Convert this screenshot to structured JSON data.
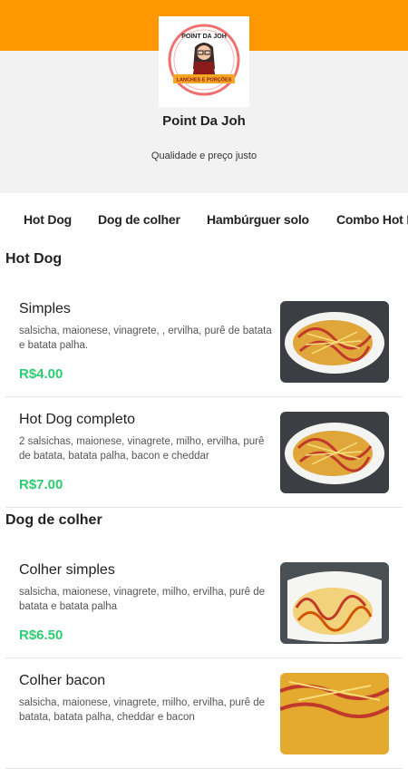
{
  "store": {
    "name": "Point Da Joh",
    "tagline": "Qualidade e preço justo",
    "logo_text_top": "POINT DA JOH",
    "logo_text_banner": "LANCHES E PORÇÕES"
  },
  "categories": [
    "Hot Dog",
    "Dog de colher",
    "Hambúrguer solo",
    "Combo Hot Dog"
  ],
  "sections": [
    {
      "title": "Hot Dog",
      "items": [
        {
          "name": "Simples",
          "description": "salsicha, maionese, vinagrete, , ervilha, purê de batata e batata palha.",
          "price": "R$4.00"
        },
        {
          "name": "Hot Dog completo",
          "description": "2 salsichas, maionese, vinagrete, milho, ervilha, purê de batata, batata palha, bacon e cheddar",
          "price": "R$7.00"
        }
      ]
    },
    {
      "title": "Dog de colher",
      "items": [
        {
          "name": "Colher simples",
          "description": "salsicha, maionese, vinagrete, milho, ervilha, purê de batata e batata palha",
          "price": "R$6.50"
        },
        {
          "name": "Colher bacon",
          "description": "salsicha, maionese, vinagrete, milho, ervilha, purê de batata, batata palha, cheddar e bacon",
          "price": ""
        }
      ]
    }
  ],
  "colors": {
    "brand": "#ff9800",
    "price": "#2ecc71",
    "header_bg": "#f2f2f2"
  }
}
